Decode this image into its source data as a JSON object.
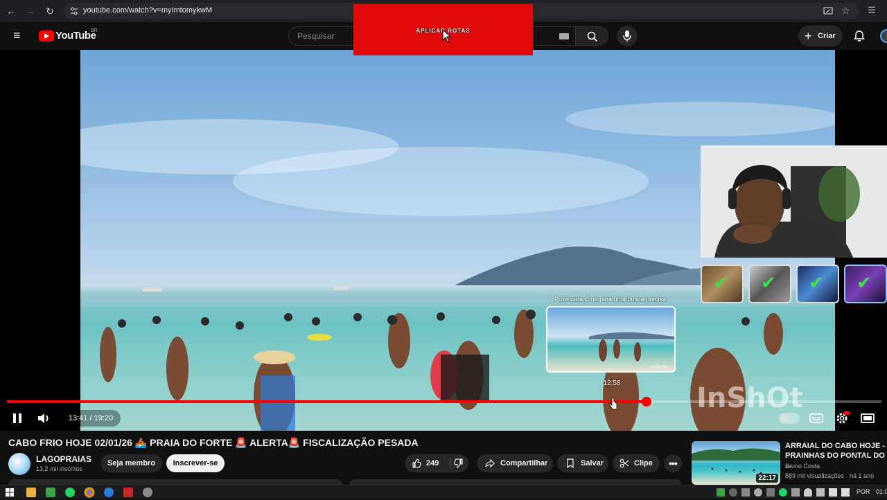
{
  "browser": {
    "url": "youtube.com/watch?v=myImtomykwM",
    "icons": [
      "back-icon",
      "forward-icon",
      "reload-icon",
      "site-settings-icon",
      "cast-icon",
      "bookmark-star-icon",
      "extensions-icon"
    ]
  },
  "header": {
    "logo_text": "YouTube",
    "logo_region": "BR",
    "search_placeholder": "Pesquisar",
    "create_label": "Criar"
  },
  "overlay_banner": {
    "text": "APLICAR ROTAS",
    "color": "#e00a0a"
  },
  "player": {
    "preview_tip": "⌃ Puxe para cima para uma busca precisa",
    "preview_time": "12:58",
    "watermark": "InShOt",
    "current_time": "13:41",
    "duration": "19:20",
    "time_display": "13:41 / 19:20",
    "progress_fraction": 0.731,
    "accent": "#ff0000"
  },
  "video": {
    "title": "CABO FRIO HOJE 02/01/26 🚣 PRAIA DO FORTE 🚨 ALERTA🚨 FISCALIZAÇÃO PESADA",
    "channel_name": "LAGOPRAIAS",
    "subscribers": "13,2 mil inscritos",
    "member_label": "Seja membro",
    "subscribe_label": "Inscrever-se",
    "likes": "249",
    "share_label": "Compartilhar",
    "save_label": "Salvar",
    "clip_label": "Clipe"
  },
  "recommended": {
    "title": "ARRAIAL DO CABO HOJE - PRAINHAS DO PONTAL DO ...",
    "channel": "Bruno Costa",
    "meta": "889 mil visualizações · há 1 ano",
    "duration": "22:17"
  },
  "taskbar": {
    "language": "POR",
    "clock": "01:0"
  }
}
